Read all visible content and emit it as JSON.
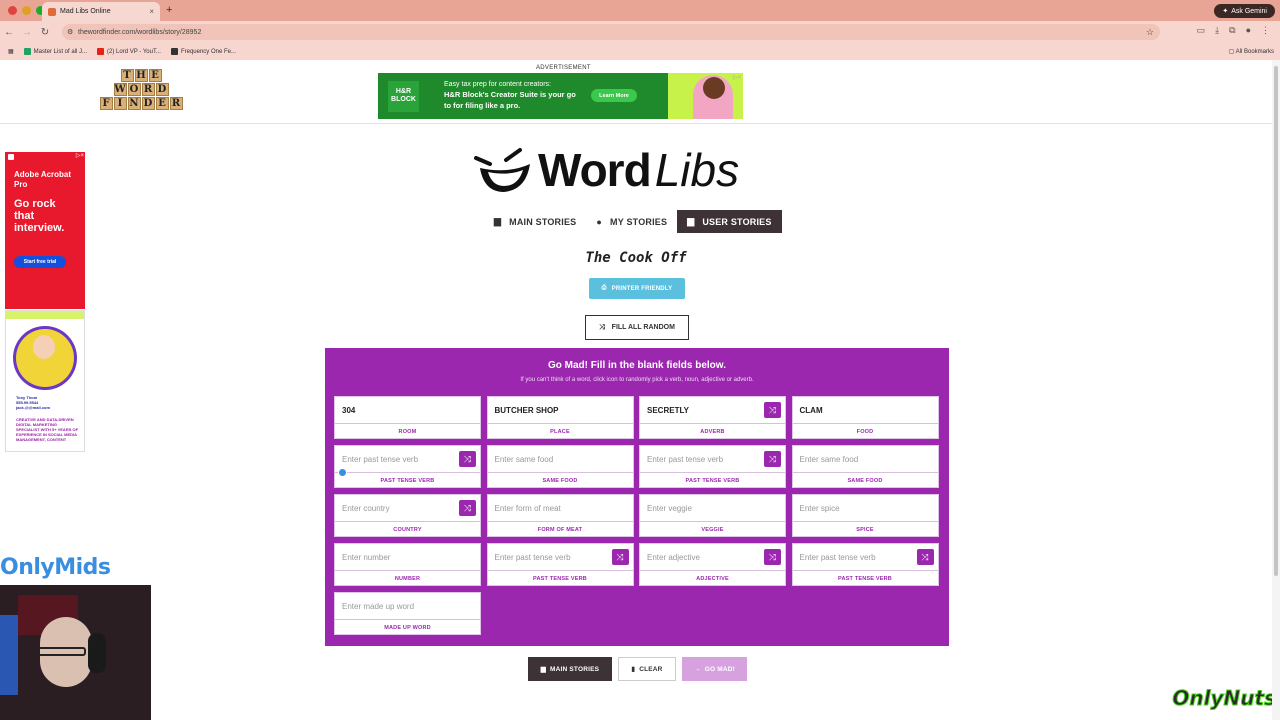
{
  "browser": {
    "tab_title": "Mad Libs Online",
    "url": "thewordfinder.com/wordlibs/story/28952",
    "gemini_label": "Ask Gemini",
    "bookmarks": [
      "Master List of all J...",
      "(2) Lord VP - YouT...",
      "Frequency One Fe..."
    ],
    "all_bookmarks": "All Bookmarks"
  },
  "site": {
    "logo_rows": [
      [
        "T",
        "H",
        "E"
      ],
      [
        "W",
        "O",
        "R",
        "D"
      ],
      [
        "F",
        "I",
        "N",
        "D",
        "E",
        "R"
      ]
    ],
    "ad_label": "ADVERTISEMENT",
    "ad": {
      "brand": "H&R BLOCK",
      "line1": "Easy tax prep for content creators:",
      "line2": "H&R Block's Creator Suite is your go",
      "line3": "to for filing like a pro.",
      "cta": "Learn More"
    },
    "side_ad": {
      "brand": "Adobe Acrobat Pro",
      "headline": "Go rock that interview.",
      "cta": "Start free trial"
    },
    "side_ad2": {
      "name": "Tony Thom",
      "contact1": "555.99.5544",
      "contact2": "jack.@@mail.com",
      "blurb": "CREATIVE AND DATA-DRIVEN DIGITAL MARKETING SPECIALIST WITH 5+ YEARS OF EXPERIENCE IN SOCIAL MEDIA MANAGEMENT, CONTENT"
    },
    "brand_overlay": "OnlyMids",
    "brand_overlay2": "OnlyNuts"
  },
  "app": {
    "logo_word": "Word",
    "logo_libs": "Libs",
    "tabs": [
      {
        "label": "MAIN STORIES",
        "icon": "book-icon"
      },
      {
        "label": "MY STORIES",
        "icon": "user-icon"
      },
      {
        "label": "USER STORIES",
        "icon": "book-icon",
        "active": true
      }
    ],
    "story_title": "The Cook Off",
    "printer_label": "PRINTER FRIENDLY",
    "random_label": "FILL ALL RANDOM",
    "panel_title": "Go Mad! Fill in the blank fields below.",
    "panel_sub": "If you can't think of a word, click icon to randomly pick a verb, noun, adjective or adverb.",
    "fields": [
      {
        "value": "304",
        "placeholder": "",
        "label": "ROOM",
        "shuffle": false
      },
      {
        "value": "BUTCHER SHOP",
        "placeholder": "",
        "label": "PLACE",
        "shuffle": false
      },
      {
        "value": "SECRETLY",
        "placeholder": "",
        "label": "ADVERB",
        "shuffle": true
      },
      {
        "value": "CLAM",
        "placeholder": "",
        "label": "FOOD",
        "shuffle": false
      },
      {
        "value": "",
        "placeholder": "Enter past tense verb",
        "label": "PAST TENSE VERB",
        "shuffle": true
      },
      {
        "value": "",
        "placeholder": "Enter same food",
        "label": "SAME FOOD",
        "shuffle": false
      },
      {
        "value": "",
        "placeholder": "Enter past tense verb",
        "label": "PAST TENSE VERB",
        "shuffle": true
      },
      {
        "value": "",
        "placeholder": "Enter same food",
        "label": "SAME FOOD",
        "shuffle": false
      },
      {
        "value": "",
        "placeholder": "Enter country",
        "label": "COUNTRY",
        "shuffle": true
      },
      {
        "value": "",
        "placeholder": "Enter form of meat",
        "label": "FORM OF MEAT",
        "shuffle": false
      },
      {
        "value": "",
        "placeholder": "Enter veggie",
        "label": "VEGGIE",
        "shuffle": false
      },
      {
        "value": "",
        "placeholder": "Enter spice",
        "label": "SPICE",
        "shuffle": false
      },
      {
        "value": "",
        "placeholder": "Enter number",
        "label": "NUMBER",
        "shuffle": false
      },
      {
        "value": "",
        "placeholder": "Enter past tense verb",
        "label": "PAST TENSE VERB",
        "shuffle": true
      },
      {
        "value": "",
        "placeholder": "Enter adjective",
        "label": "ADJECTIVE",
        "shuffle": true
      },
      {
        "value": "",
        "placeholder": "Enter past tense verb",
        "label": "PAST TENSE VERB",
        "shuffle": true
      },
      {
        "value": "",
        "placeholder": "Enter made up word",
        "label": "MADE UP WORD",
        "shuffle": false
      }
    ],
    "bottom": {
      "main": "MAIN STORIES",
      "clear": "CLEAR",
      "go": "GO MAD!"
    }
  },
  "colors": {
    "accent": "#9b27af",
    "dark": "#3d3236",
    "info": "#5bc0de",
    "chrome": "#e8a596"
  }
}
